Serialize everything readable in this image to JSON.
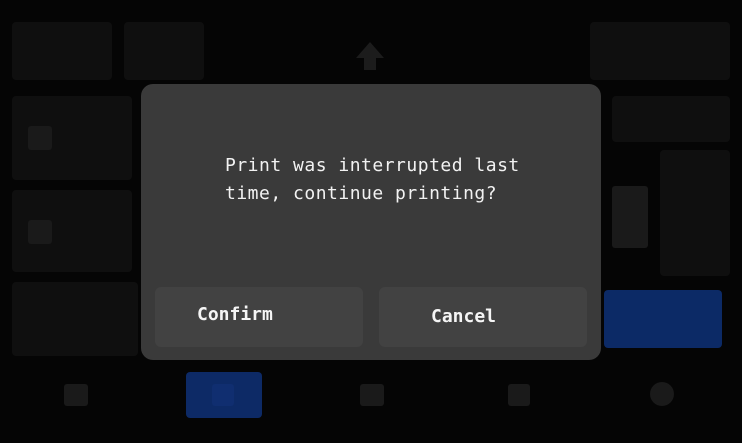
{
  "dialog": {
    "message": "Print was interrupted last\ntime, continue printing?",
    "confirm_label": "Confirm",
    "cancel_label": "Cancel"
  },
  "colors": {
    "overlay": "#050505",
    "dialog_bg": "#3a3a3a",
    "button_bg": "#424242",
    "text": "#f2f2f2",
    "accent_blue": "#0c2a66"
  },
  "background_icons": {
    "top_upload": "upload-icon",
    "bottom_nav": [
      "home-icon",
      "files-icon",
      "print-icon",
      "tools-icon",
      "settings-icon"
    ]
  }
}
